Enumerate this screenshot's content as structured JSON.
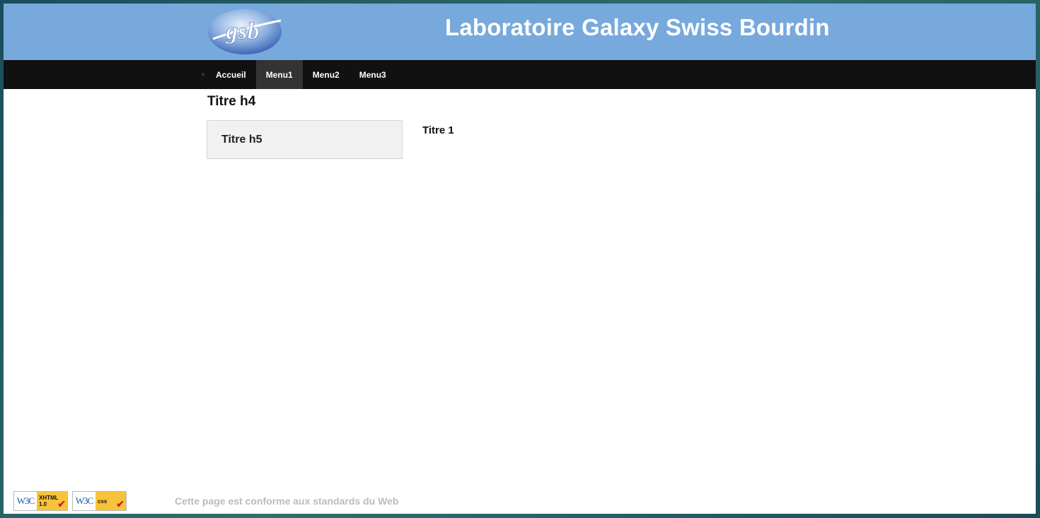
{
  "header": {
    "logo_text": "gsb",
    "title": "Laboratoire Galaxy Swiss Bourdin"
  },
  "nav": {
    "items": [
      {
        "label": "Accueil"
      },
      {
        "label": "Menu1"
      },
      {
        "label": "Menu2"
      },
      {
        "label": "Menu3"
      }
    ],
    "active": "Menu1"
  },
  "main": {
    "heading": "Titre h4",
    "sidebar_title": "Titre h5",
    "content_title": "Titre 1"
  },
  "footer": {
    "badges": [
      {
        "w3c": "W3C",
        "label": "XHTML",
        "version": "1.0"
      },
      {
        "w3c": "W3C",
        "label": "css"
      }
    ],
    "text": "Cette page est conforme aux standards du Web"
  },
  "colors": {
    "header_bg": "#77a9dc",
    "nav_bg": "#111111",
    "nav_active_bg": "#333333",
    "sidebar_bg": "#f1f1f1",
    "badge_bg": "#f8c33a",
    "badge_check": "#c0262d"
  },
  "icons": {
    "badge_check": "check-mark-icon",
    "nav_bullet": "bullet-icon"
  }
}
